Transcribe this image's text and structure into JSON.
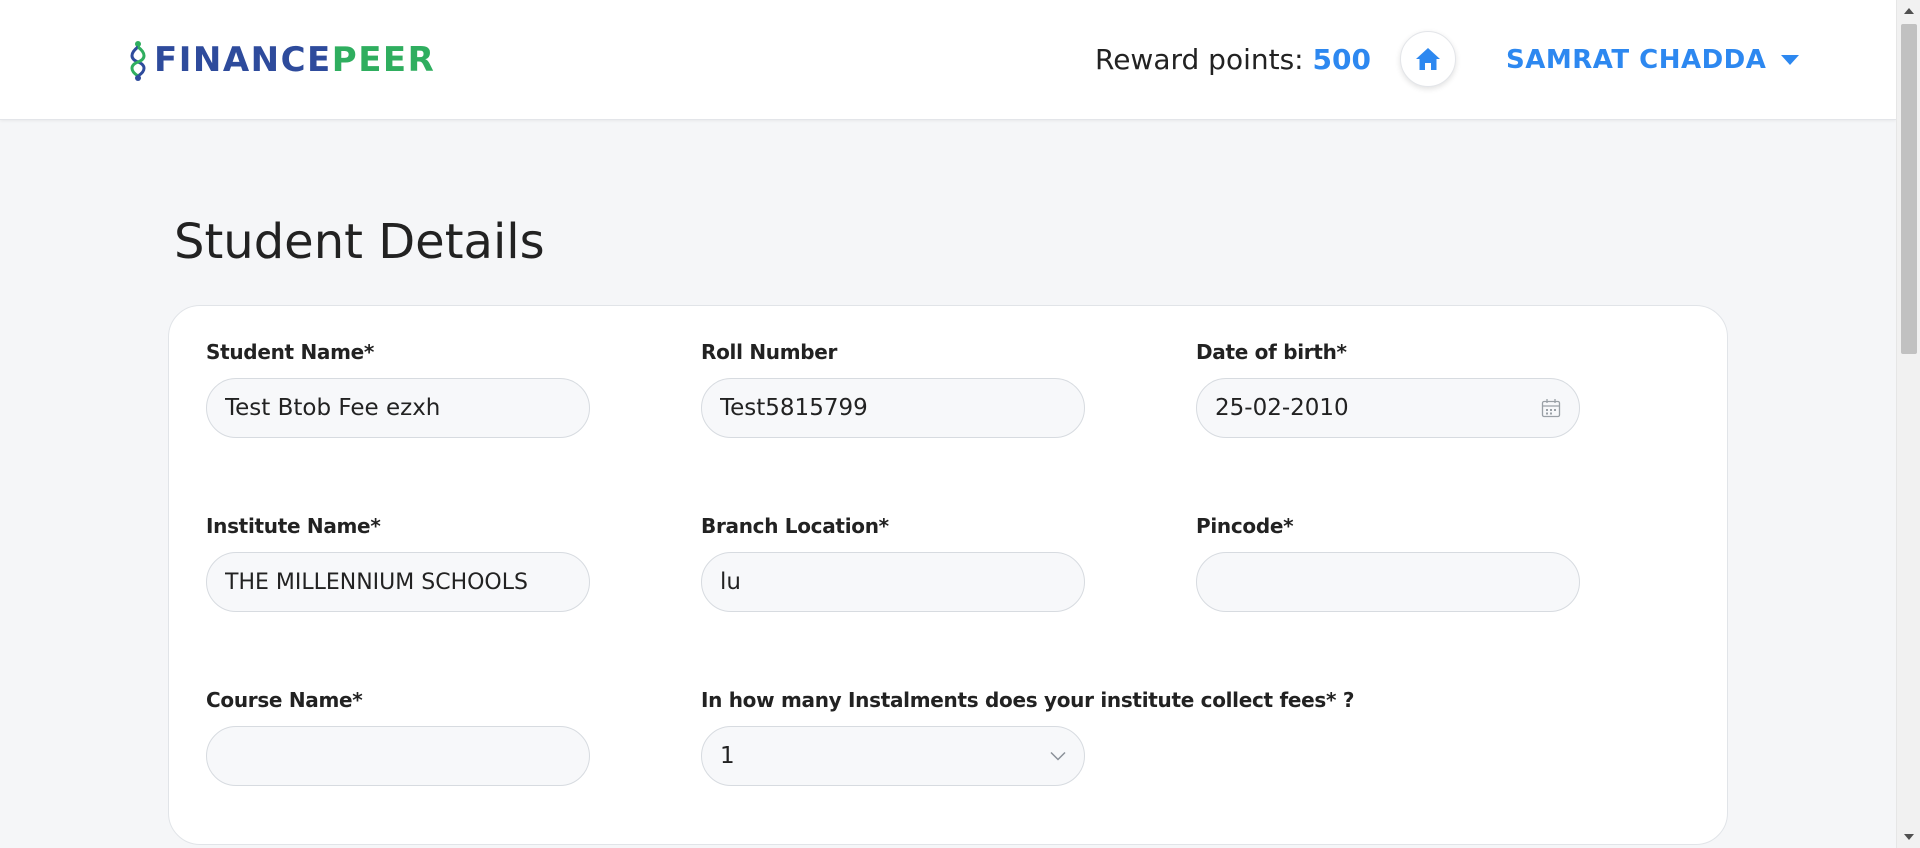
{
  "header": {
    "logo_finance": "FINANCE",
    "logo_peer": "PEER",
    "reward_label": "Reward points: ",
    "reward_value": "500",
    "user_name": "SAMRAT CHADDA"
  },
  "page": {
    "title": "Student Details"
  },
  "form": {
    "student_name": {
      "label": "Student Name*",
      "value": "Test Btob Fee ezxh"
    },
    "roll_number": {
      "label": "Roll Number",
      "value": "Test5815799"
    },
    "date_of_birth": {
      "label": "Date of birth*",
      "value": "25-02-2010"
    },
    "institute_name": {
      "label": "Institute Name*",
      "value": "THE MILLENNIUM SCHOOLS"
    },
    "branch_location": {
      "label": "Branch Location*",
      "value": "lu"
    },
    "pincode": {
      "label": "Pincode*",
      "value": ""
    },
    "course_name": {
      "label": "Course Name*",
      "value": ""
    },
    "instalments": {
      "label": "In how many Instalments does your institute collect fees* ?",
      "value": "1"
    }
  },
  "colors": {
    "accent": "#2d88f0",
    "logo_blue": "#2e4b9c",
    "logo_green": "#2fae5f"
  },
  "icons": {
    "home": "home-icon",
    "dropdown": "caret-down-icon",
    "calendar": "calendar-icon",
    "select": "chevron-down-icon"
  }
}
